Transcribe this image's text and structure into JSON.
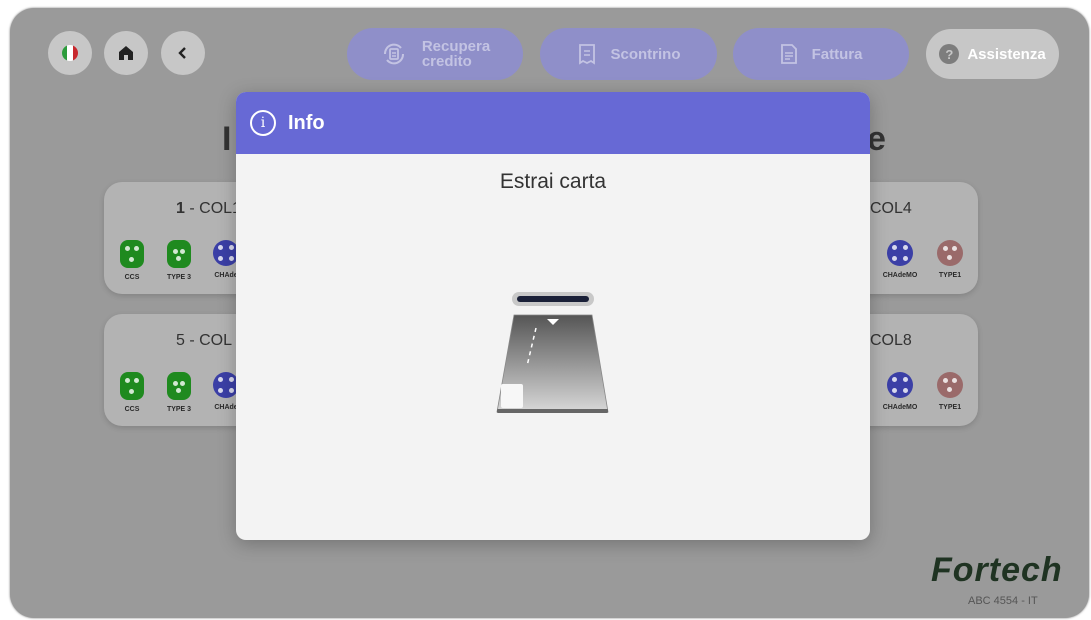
{
  "topbar": {
    "language_icon": "italy-flag-icon",
    "home_icon": "home-icon",
    "back_icon": "chevron-left-icon",
    "buttons": [
      {
        "label_line1": "Recupera",
        "label_line2": "credito",
        "icon": "refresh-receipt-icon"
      },
      {
        "label": "Scontrino",
        "icon": "receipt-icon"
      },
      {
        "label": "Fattura",
        "icon": "invoice-icon"
      }
    ],
    "assist": {
      "label": "Assistenza",
      "icon_glyph": "?"
    }
  },
  "background": {
    "title_left_fragment": "I",
    "title_right_fragment": "e",
    "stations": [
      {
        "number": "1",
        "name": "- COL1",
        "connectors": [
          "CCS",
          "TYPE 3",
          "CHAde"
        ]
      },
      {
        "number": "",
        "name": "COL4",
        "connectors": [
          "CHAdeMO",
          "TYPE1"
        ]
      },
      {
        "number": "",
        "name": "5 - COL",
        "connectors": [
          "CCS",
          "TYPE 3",
          "CHAde"
        ]
      },
      {
        "number": "",
        "name": "COL8",
        "connectors": [
          "CHAdeMO",
          "TYPE1"
        ]
      }
    ]
  },
  "brand": {
    "logo": "Fortech",
    "serial": "ABC 4554 - IT"
  },
  "modal": {
    "title": "Info",
    "icon_glyph": "i",
    "message": "Estrai carta",
    "illustration": "card-eject-icon"
  },
  "colors": {
    "modal_header": "#6769d5",
    "connector_green": "#1f8a1f",
    "connector_blue": "#3b3fa6",
    "connector_type1": "#9a6a6a"
  }
}
